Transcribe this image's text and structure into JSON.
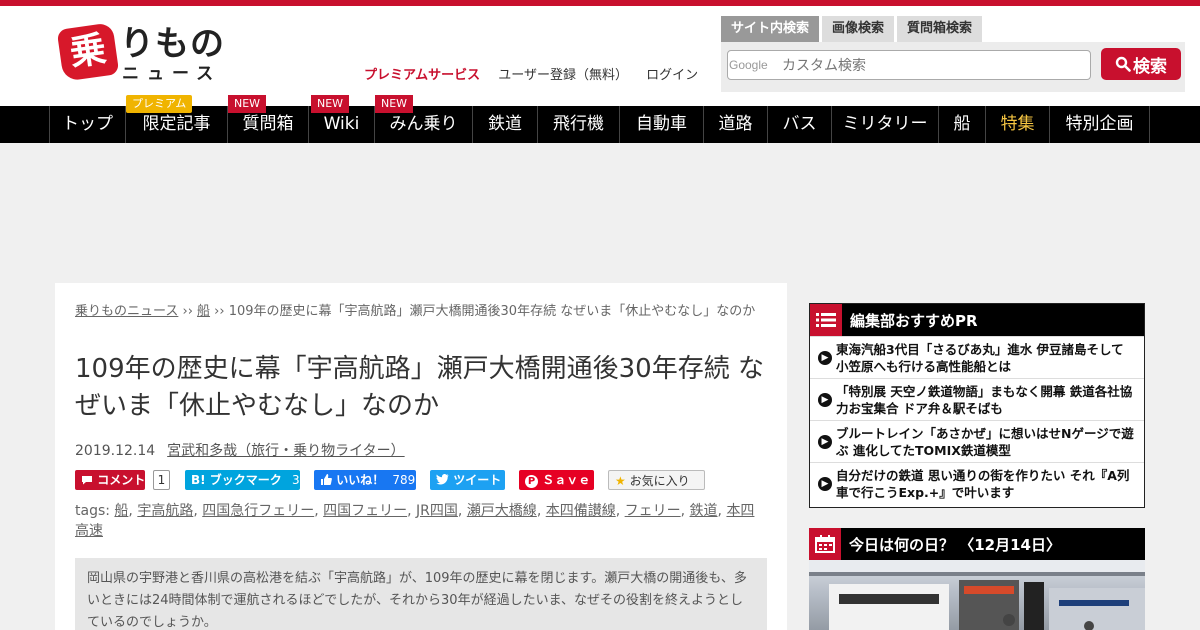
{
  "site": {
    "logo_mark": "乗",
    "logo_main": "りもの",
    "logo_sub": "ニュース",
    "brand_color": "#c8102e"
  },
  "header": {
    "links": [
      "プレミアムサービス",
      "ユーザー登録（無料）",
      "ログイン"
    ],
    "search_tabs": [
      "サイト内検索",
      "画像検索",
      "質問箱検索"
    ],
    "search_placeholder": "カスタム検索",
    "search_brand": "Google",
    "search_button": "検索"
  },
  "nav": {
    "items": [
      {
        "label": "トップ"
      },
      {
        "label": "限定記事",
        "badge": "プレミアム"
      },
      {
        "label": "質問箱",
        "badge": "NEW"
      },
      {
        "label": "Wiki",
        "badge": "NEW"
      },
      {
        "label": "みん乗り",
        "badge": "NEW"
      },
      {
        "label": "鉄道"
      },
      {
        "label": "飛行機"
      },
      {
        "label": "自動車"
      },
      {
        "label": "道路"
      },
      {
        "label": "バス"
      },
      {
        "label": "ミリタリー"
      },
      {
        "label": "船"
      },
      {
        "label": "特集"
      },
      {
        "label": "特別企画"
      }
    ]
  },
  "article": {
    "breadcrumb": {
      "home": "乗りものニュース",
      "sep": " ›› ",
      "category": "船",
      "current": "109年の歴史に幕「宇高航路」瀬戸大橋開通後30年存続 なぜいま「休止やむなし」なのか"
    },
    "title": "109年の歴史に幕「宇高航路」瀬戸大橋開通後30年存続 なぜいま「休止やむなし」なのか",
    "date": "2019.12.14",
    "author": "宮武和多哉（旅行・乗り物ライター）",
    "social": {
      "comment": "コメント",
      "comment_count": "1",
      "hatena": "B! ブックマーク",
      "hatena_count": "3",
      "like": "いいね！",
      "like_count": "789",
      "tweet": "ツイート",
      "save": "Ｓａｖｅ",
      "favorite": "お気に入り"
    },
    "tags_label": "tags: ",
    "tags": [
      "船",
      "宇高航路",
      "四国急行フェリー",
      "四国フェリー",
      "JR四国",
      "瀬戸大橋線",
      "本四備讃線",
      "フェリー",
      "鉄道",
      "本四高速"
    ],
    "lead": "岡山県の宇野港と香川県の高松港を結ぶ「宇高航路」が、109年の歴史に幕を閉じます。瀬戸大橋の開通後も、多いときには24時間体制で運航されるほどでしたが、それから30年が経過したいま、なぜその役割を終えようとしているのでしょうか。"
  },
  "sidebar": {
    "pr_title": "編集部おすすめPR",
    "pr_items": [
      "東海汽船3代目「さるびあ丸」進水 伊豆諸島そして小笠原へも行ける高性能船とは",
      "「特別展 天空ノ鉄道物語」まもなく開幕 鉄道各社協力お宝集合 ドア弁＆駅そばも",
      "ブルートレイン「あさかぜ」に想いはせNゲージで遊ぶ 進化してたTOMIX鉄道模型",
      "自分だけの鉄道 思い通りの街を作りたい それ『A列車で行こうExp.+』で叶います"
    ],
    "today_title": "今日は何の日？ 〈12月14日〉"
  }
}
